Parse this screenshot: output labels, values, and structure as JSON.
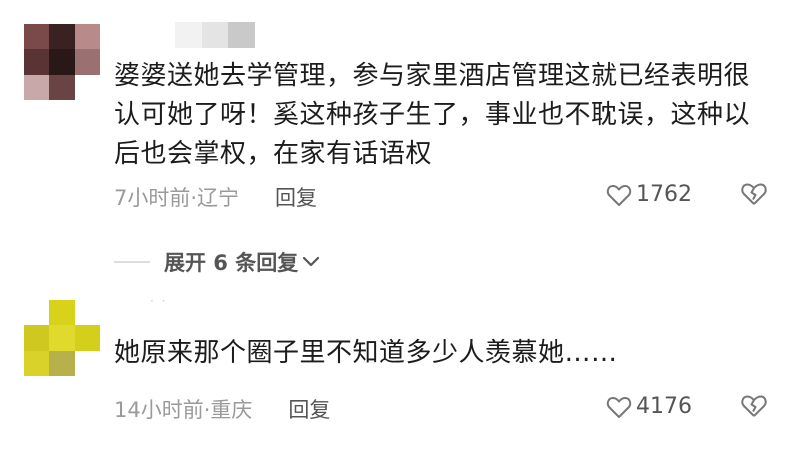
{
  "comments": [
    {
      "text": "婆婆送她去学管理，参与家里酒店管理这就已经表明很认可她了呀！奚这种孩子生了，事业也不耽误，这种以后也会掌权，在家有话语权",
      "time": "7小时前·辽宁",
      "reply_label": "回复",
      "likes": "1762",
      "expand_label": "展开 6 条回复"
    },
    {
      "text": "她原来那个圈子里不知道多少人羡慕她……",
      "time": "14小时前·重庆",
      "reply_label": "回复",
      "likes": "4176"
    }
  ],
  "icons": {
    "like": "heart-outline-icon",
    "dislike": "broken-heart-icon",
    "expand": "chevron-down-icon"
  },
  "colors": {
    "meta_text": "#9a9a9a",
    "avatar2_accent": "#d4cf1a"
  }
}
